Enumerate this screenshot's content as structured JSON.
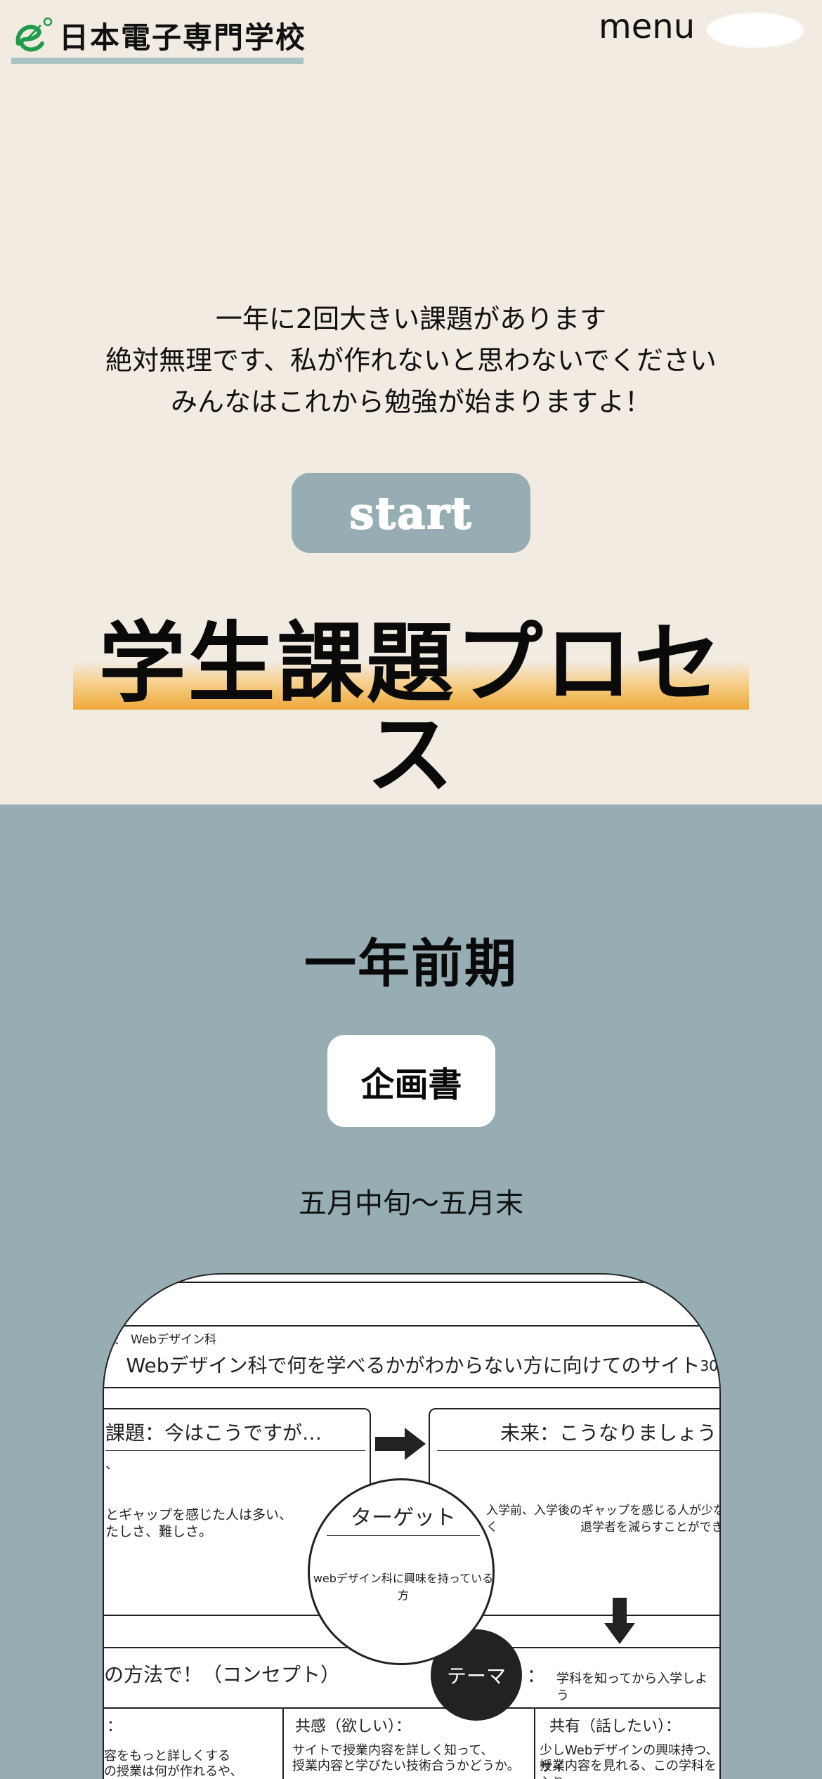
{
  "header": {
    "logo_text": "日本電子専門学校",
    "menu_label": "menu"
  },
  "intro": {
    "lines": [
      "一年に2回大きい課題があります",
      "絶対無理です、私が作れないと思わないでください",
      "みんなはこれから勉強が始まりますよ！"
    ],
    "start_label": "start"
  },
  "hero": {
    "title": "学生課題プロセス"
  },
  "section": {
    "term": "一年前期",
    "plan_label": "企画書",
    "period": "五月中旬～五月末"
  },
  "document": {
    "school_label": "校　Webデザイン科",
    "title": "Webデザイン科で何を学べるかがわからない方に向けてのサイト",
    "page": "30",
    "now_head": "課題：今はこうですが…",
    "now_mark": "、",
    "now_text_1": "とギャップを感じた人は多い、",
    "now_text_2": "たしさ、難しさ。",
    "future_head": "未来：こうなりましょう！",
    "future_text_1": "入学前、入学後のギャップを感じる人が少なく",
    "future_text_2": "退学者を減らすことができる",
    "target_head": "ターゲット",
    "target_text": "webデザイン科に興味を持っている方",
    "concept_head": "の方法で！（コンセプト）",
    "theme_label": "テーマ",
    "theme_colon": "：",
    "theme_text": "学科を知ってから入学しよう",
    "col1_head": "：",
    "col1_text_1": "容をもっと詳しくする",
    "col1_text_2": "の授業は何が作れるや、",
    "col2_head": "共感（欲しい）：",
    "col2_text_1": "サイトで授業内容を詳しく知って、",
    "col2_text_2": "授業内容と学びたい技術合うかどうか。",
    "col3_head": "共有（話したい）：",
    "col3_text_1": "少しWebデザインの興味持つ、サイ",
    "col3_text_2": "授業内容を見れる、この学科を入り"
  },
  "colors": {
    "background": "#f2ebe1",
    "section_blue": "#96adb4",
    "highlight": "#eea93a",
    "logo_green": "#1e9b4c"
  }
}
